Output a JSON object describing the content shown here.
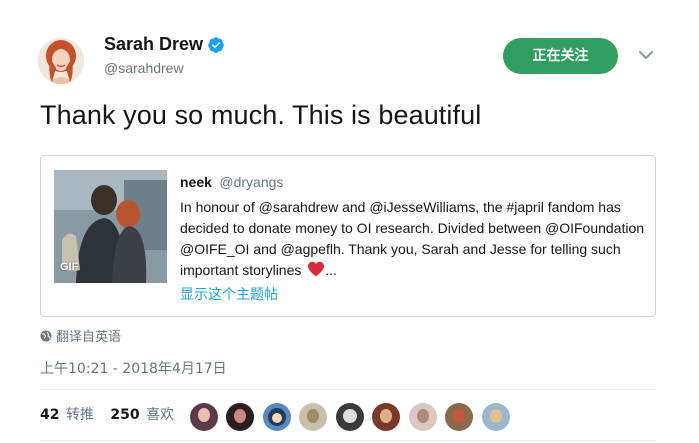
{
  "author": {
    "display_name": "Sarah Drew",
    "handle": "@sarahdrew",
    "verified": true
  },
  "follow_button": {
    "label": "正在关注"
  },
  "tweet": {
    "text": "Thank you so much. This is beautiful"
  },
  "quoted_tweet": {
    "author_name": "neek",
    "author_handle": "@dryangs",
    "text": "In honour of @sarahdrew and @iJesseWilliams, the #japril fandom has decided to donate money to OI research. Divided between @OIFoundation @OIFE_OI and @agpeflh. Thank you, Sarah and Jesse for telling such important storylines",
    "text_suffix": "...",
    "media_badge": "GIF",
    "thread_link": "显示这个主题帖"
  },
  "translate_label": "翻译自英语",
  "timestamp": "上午10:21 - 2018年4月17日",
  "stats": {
    "retweets_count": "42",
    "retweets_label": "转推",
    "likes_count": "250",
    "likes_label": "喜欢"
  },
  "colors": {
    "follow_green": "#2f9e5f",
    "link_blue": "#1da1f2",
    "secondary_text": "#657786",
    "heart_red": "#e0245e",
    "verified_blue": "#1da1f2"
  },
  "icons": [
    "verified-badge-icon",
    "chevron-down-icon",
    "heart-emoji-icon",
    "globe-icon"
  ]
}
